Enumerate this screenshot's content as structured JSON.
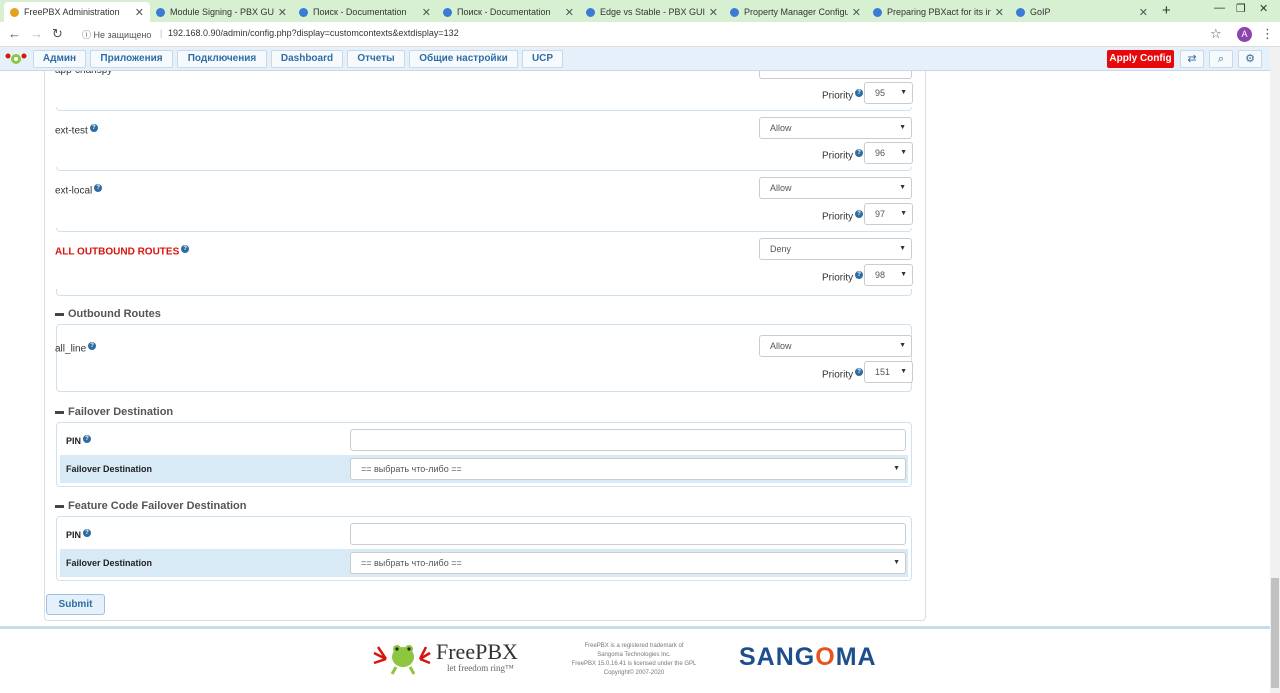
{
  "browser": {
    "tabs": [
      {
        "label": "FreePBX Administration",
        "active": true,
        "icon": "freepbx"
      },
      {
        "label": "Module Signing - PBX GUI - ",
        "icon": "globe"
      },
      {
        "label": "Поиск - Documentation",
        "icon": "globe"
      },
      {
        "label": "Поиск - Documentation",
        "icon": "globe"
      },
      {
        "label": "Edge vs Stable - PBX GUI - D",
        "icon": "globe"
      },
      {
        "label": "Property Manager Configur",
        "icon": "globe"
      },
      {
        "label": "Preparing PBXact for its inte",
        "icon": "globe"
      },
      {
        "label": "GoIP",
        "icon": "globe"
      }
    ],
    "security_label": "Не защищено",
    "url": "192.168.0.90/admin/config.php?display=customcontexts&extdisplay=132",
    "profile_initial": "A"
  },
  "nav": {
    "items": [
      "Админ",
      "Приложения",
      "Подключения",
      "Dashboard",
      "Отчеты",
      "Общие настройки",
      "UCP"
    ],
    "apply_config": "Apply Config"
  },
  "contexts": [
    {
      "name": "app-chanspy",
      "permission": "",
      "priority": "95"
    },
    {
      "name": "ext-test",
      "permission": "Allow",
      "priority": "96"
    },
    {
      "name": "ext-local",
      "permission": "Allow",
      "priority": "97"
    },
    {
      "name": "ALL OUTBOUND ROUTES",
      "permission": "Deny",
      "priority": "98",
      "highlight": true
    }
  ],
  "priority_label": "Priority",
  "outbound": {
    "title": "Outbound Routes",
    "routes": [
      {
        "name": "all_line",
        "permission": "Allow",
        "priority": "151"
      }
    ]
  },
  "failover": {
    "title": "Failover Destination",
    "pin_label": "PIN",
    "pin_value": "",
    "dest_label": "Failover Destination",
    "dest_value": "== выбрать что-либо =="
  },
  "feature_failover": {
    "title": "Feature Code Failover Destination",
    "pin_label": "PIN",
    "pin_value": "",
    "dest_label": "Failover Destination",
    "dest_value": "== выбрать что-либо =="
  },
  "submit_label": "Submit",
  "footer": {
    "brand": "FreePBX",
    "tagline": "let freedom ring™",
    "legal_1": "FreePBX is a registered trademark of",
    "legal_2": "Sangoma Technologies Inc.",
    "legal_3": "FreePBX 15.0.16.41 is licensed under the GPL",
    "legal_4": "Copyright© 2007-2020",
    "sangoma_left": "SANG",
    "sangoma_o": "O",
    "sangoma_right": "MA"
  },
  "colors": {
    "accent": "#2e6da4",
    "apply": "#e8070a",
    "deny_label": "#d9130d",
    "row_highlight": "#d9eaf7"
  }
}
